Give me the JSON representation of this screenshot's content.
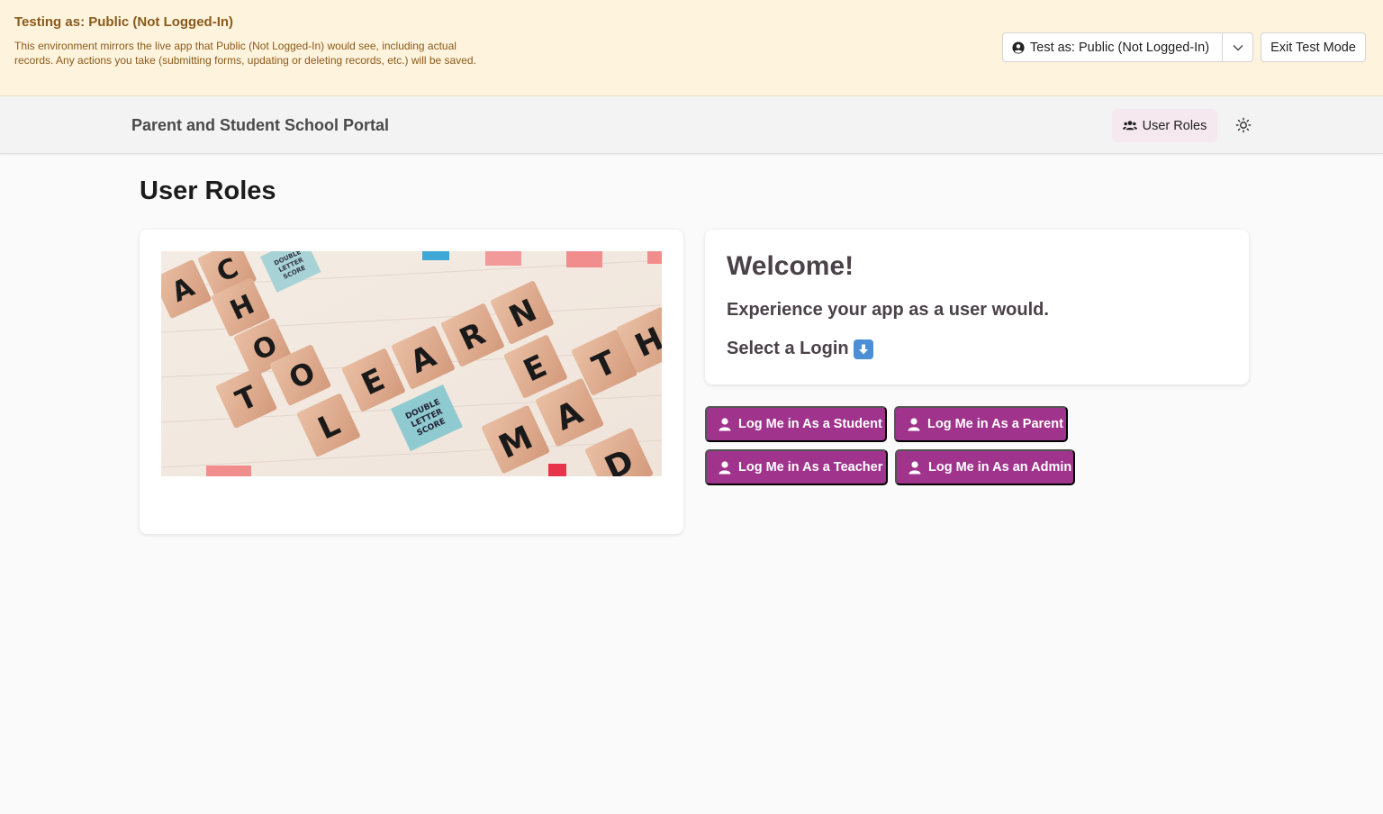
{
  "banner": {
    "title": "Testing as: Public (Not Logged-In)",
    "description": "This environment mirrors the live app that Public (Not Logged-In) would see, including actual records. Any actions you take (submitting forms, updating or deleting records, etc.) will be saved.",
    "role_select_label": "Test as: Public (Not Logged-In)",
    "exit_label": "Exit Test Mode",
    "text_color": "#8a5a1c",
    "background": "#fef3dc"
  },
  "nav": {
    "app_title": "Parent and Student School Portal",
    "roles_label": "User Roles",
    "theme_icon": "sun-icon"
  },
  "main": {
    "page_title": "User Roles",
    "welcome": {
      "heading": "Welcome!",
      "subheading": "Experience your app as a user would.",
      "select_prompt": "Select a Login"
    },
    "hero_image": {
      "alt_tiles": [
        "A",
        "C",
        "H",
        "O",
        "O",
        "T",
        "L",
        "E",
        "A",
        "R",
        "N",
        "E",
        "M",
        "A",
        "T",
        "H",
        "D"
      ],
      "badges": [
        "DOUBLE LETTER SCORE",
        "DOUBLE LETTER SCORE"
      ]
    },
    "logins": [
      {
        "label": "Log Me in As a Student"
      },
      {
        "label": "Log Me in As a Parent"
      },
      {
        "label": "Log Me in As a Teacher"
      },
      {
        "label": "Log Me in As an Admin"
      }
    ],
    "accent_color": "#a0338c"
  }
}
